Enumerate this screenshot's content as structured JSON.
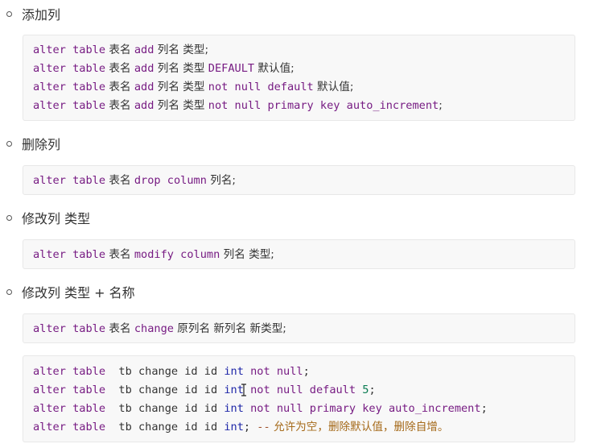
{
  "sections": [
    {
      "heading": "添加列",
      "lines": [
        {
          "kw1": "alter table",
          "t1": " 表名 ",
          "kw2": "add",
          "t2": " 列名 类型;"
        },
        {
          "kw1": "alter table",
          "t1": " 表名 ",
          "kw2": "add",
          "t2": " 列名 类型 ",
          "kw3": "DEFAULT",
          "t3": " 默认值;"
        },
        {
          "kw1": "alter table",
          "t1": " 表名 ",
          "kw2": "add",
          "t2": " 列名 类型 ",
          "kw3": "not null default",
          "t3": " 默认值;"
        },
        {
          "kw1": "alter table",
          "t1": " 表名 ",
          "kw2": "add",
          "t2": " 列名 类型 ",
          "kw3": "not null primary key auto_increment",
          "t3": ";"
        }
      ]
    },
    {
      "heading": "删除列",
      "lines": [
        {
          "kw1": "alter table",
          "t1": " 表名 ",
          "kw2": "drop column",
          "t2": " 列名;"
        }
      ]
    },
    {
      "heading": "修改列 类型",
      "lines": [
        {
          "kw1": "alter table",
          "t1": " 表名 ",
          "kw2": "modify column",
          "t2": " 列名 类型;"
        }
      ]
    },
    {
      "heading": "修改列 类型 + 名称",
      "lines": [
        {
          "kw1": "alter table",
          "t1": " 表名 ",
          "kw2": "change",
          "t2": " 原列名 新列名 新类型;"
        }
      ]
    }
  ],
  "example": {
    "lines": [
      {
        "kw1": "alter table",
        "t1": "  tb change id id ",
        "type": "int",
        "kw2": " not null",
        "t2": ";"
      },
      {
        "kw1": "alter table",
        "t1": "  tb change id id ",
        "type": "int",
        "kw2": " not null default",
        "t2": " ",
        "num": "5",
        "t3": ";"
      },
      {
        "kw1": "alter table",
        "t1": "  tb change id id ",
        "type": "int",
        "kw2": " not null primary key auto_increment",
        "t2": ";"
      },
      {
        "kw1": "alter table",
        "t1": "  tb change id id ",
        "type": "int",
        "t2": "; ",
        "comment_mark": "--",
        "comment": " 允许为空，删除默认值，删除自增。"
      }
    ]
  }
}
